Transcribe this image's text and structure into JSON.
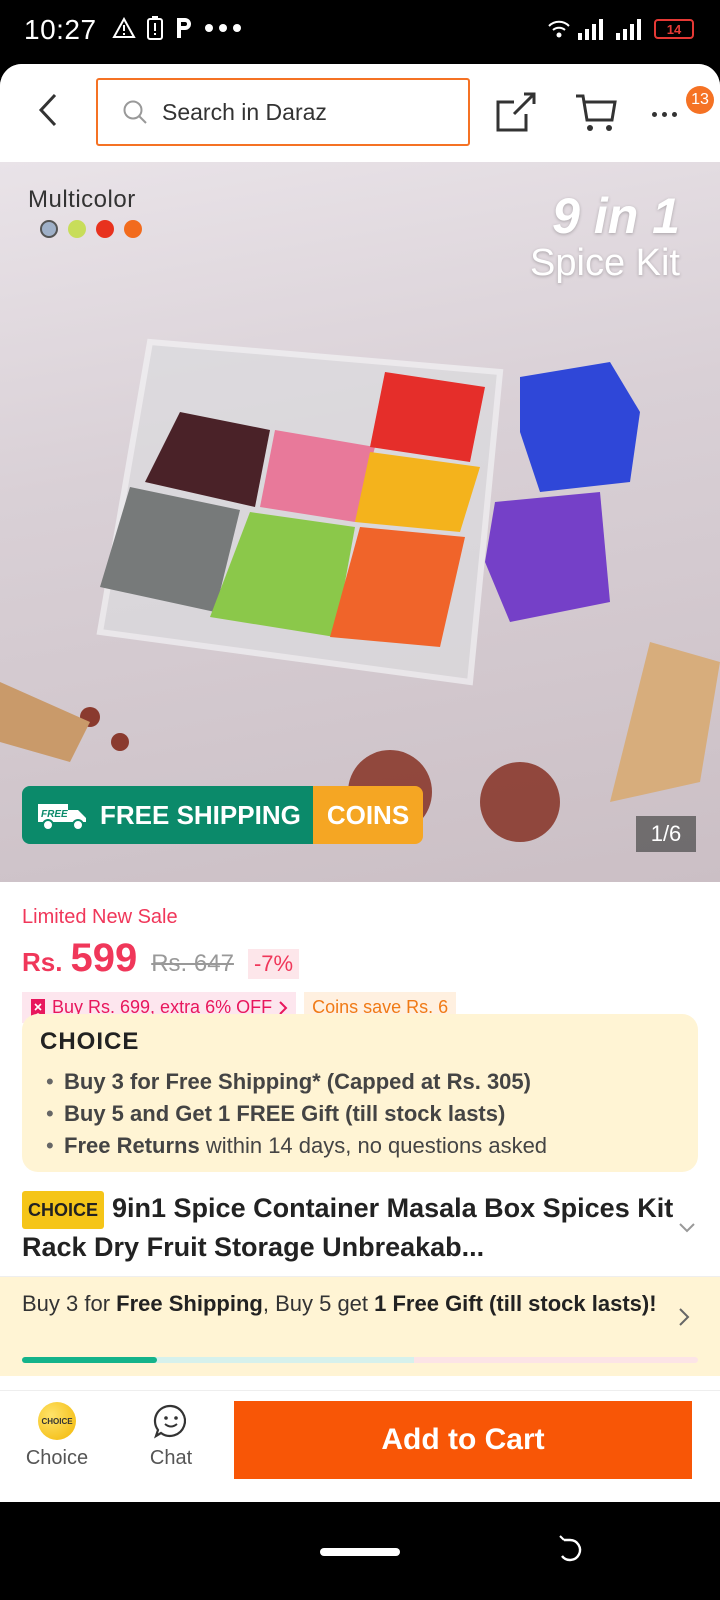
{
  "status_bar": {
    "time": "10:27",
    "battery": "14"
  },
  "top_bar": {
    "search_placeholder": "Search in Daraz",
    "cart_badge": "13"
  },
  "product_image": {
    "variant_label": "Multicolor",
    "swatches": [
      "#9fb0c8",
      "#c8dd5a",
      "#e8321e",
      "#f26b1d"
    ],
    "kit_title_big": "9 in 1",
    "kit_title_small": "Spice Kit",
    "shipping_text": "FREE SHIPPING",
    "coins_text": "COINS",
    "free_badge": "FREE",
    "page_counter": "1/6"
  },
  "price": {
    "sale_label": "Limited New Sale",
    "currency": "Rs.",
    "current": "599",
    "original": "Rs. 647",
    "discount": "-7%",
    "promo": "Buy Rs. 699, extra 6% OFF",
    "coins_save": "Coins save Rs. 6"
  },
  "choice": {
    "logo": "CHOICE",
    "items": [
      {
        "bold": "Buy 3 for  Free Shipping* (Capped at Rs. 305)",
        "rest": ""
      },
      {
        "bold": "Buy 5 and Get 1 FREE Gift (till stock lasts)",
        "rest": ""
      },
      {
        "bold": "Free Returns",
        "rest": " within 14 days, no questions asked"
      }
    ]
  },
  "product": {
    "badge": "CHOICE",
    "title": "9in1 Spice Container Masala Box Spices Kit Rack Dry Fruit Storage Unbreakab..."
  },
  "shipping_progress": {
    "part1": "Buy 3 for ",
    "part2": "Free Shipping",
    "part3": ", Buy 5 get ",
    "part4": "1 Free Gift (till stock lasts)!",
    "progress": 0.2
  },
  "bottom_bar": {
    "choice_label": "Choice",
    "choice_coin": "CHOICE",
    "chat_label": "Chat",
    "add_to_cart": "Add to Cart"
  },
  "colors": {
    "brand": "#f85606",
    "price": "#f0375a",
    "choice_bg": "#fff4d4",
    "shipping_green": "#0b8a6a"
  }
}
